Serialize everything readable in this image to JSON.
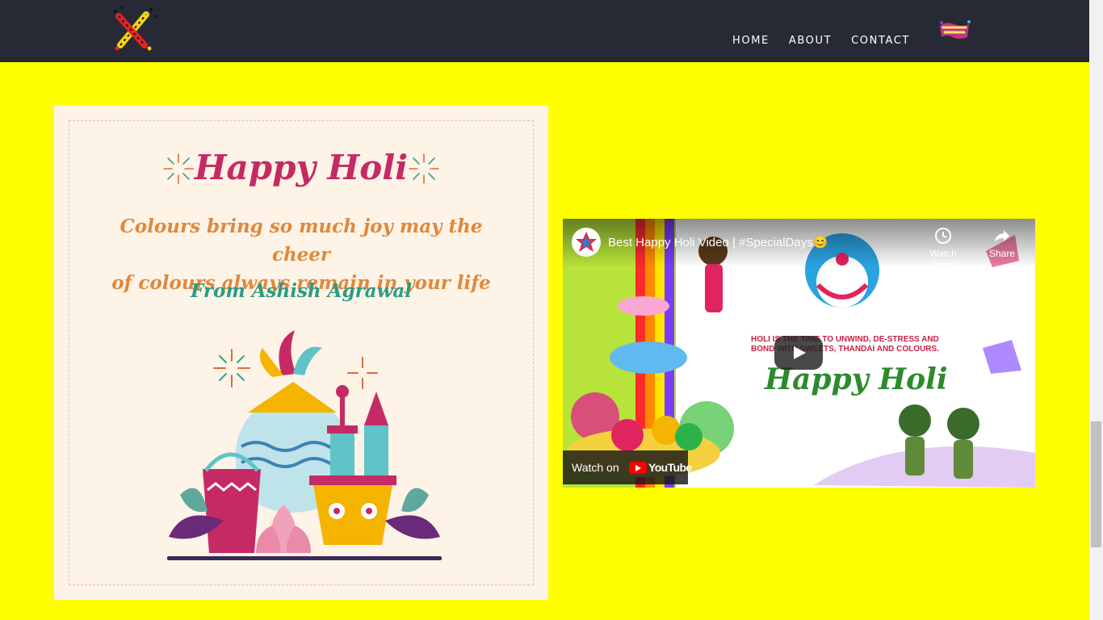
{
  "nav": {
    "logo_icon": "crossed-pichkari-icon",
    "items": [
      "HOME",
      "ABOUT",
      "CONTACT"
    ],
    "badge_icon": "happy-holi-badge-icon"
  },
  "card": {
    "title": "Happy Holi",
    "message_line1": "Colours bring so much joy may the cheer",
    "message_line2": "of colours always remain in your life",
    "from": "From  Ashish Agrawal",
    "illustration_icon": "holi-colour-pots-illustration"
  },
  "video": {
    "title": "Best Happy Holi Video | #SpecialDays😊",
    "watch_later": "Watch later",
    "share": "Share",
    "watch_on": "Watch on",
    "youtube": "YouTube",
    "headline": "HOLI IS THE TIME TO UNWIND, DE-STRESS AND BOND WITH SWEETS, THANDAI AND COLOURS.",
    "thumbnail_text": "Happy Holi"
  },
  "colors": {
    "page_bg": "#ffff00",
    "navbar_bg": "#272a35",
    "card_bg": "#fdf3e6",
    "title_pink": "#c52a65",
    "message_orange": "#e0883c",
    "from_teal": "#2c9b84"
  }
}
